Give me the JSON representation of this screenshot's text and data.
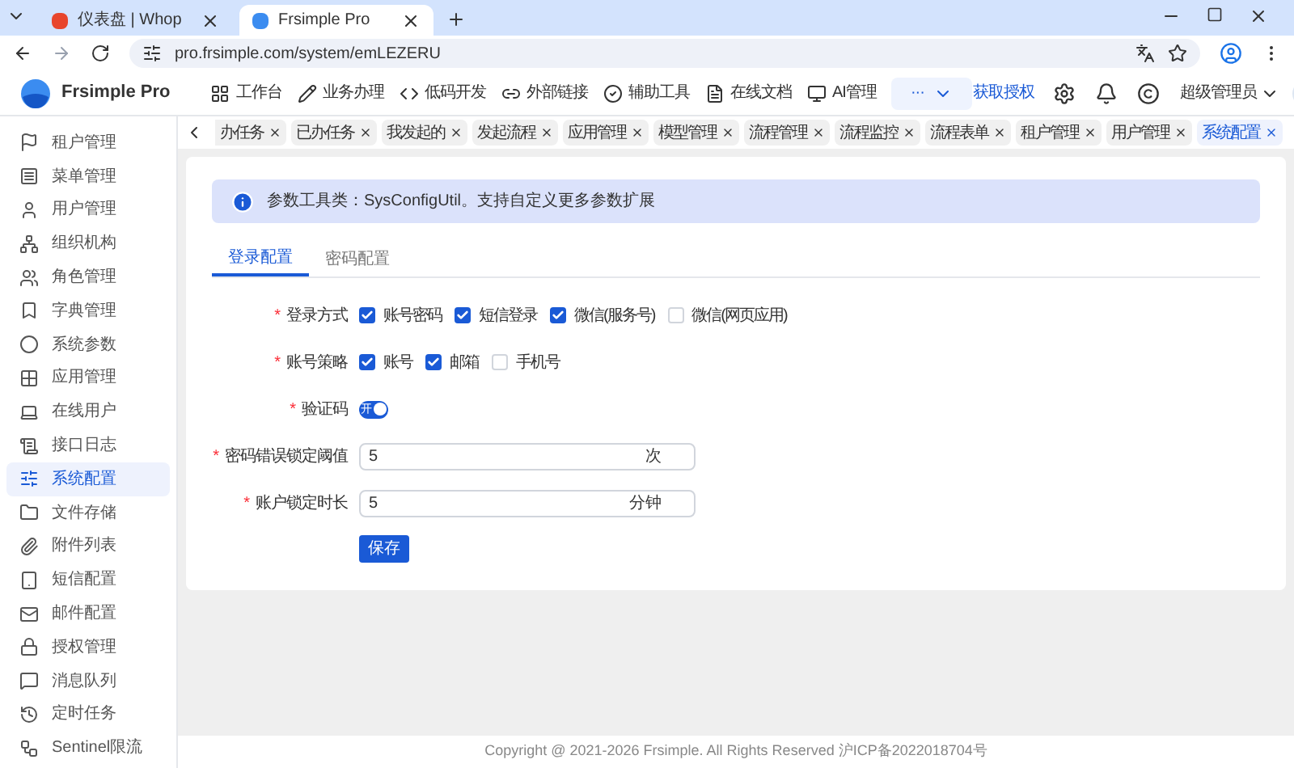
{
  "browser": {
    "tabs": [
      {
        "title": "仪表盘 | Whop",
        "selected": false
      },
      {
        "title": "Frsimple Pro",
        "selected": true
      }
    ],
    "url": "pro.frsimple.com/system/emLEZERU"
  },
  "header": {
    "logo_text": "Frsimple Pro",
    "nav": [
      {
        "label": "工作台"
      },
      {
        "label": "业务办理"
      },
      {
        "label": "低码开发"
      },
      {
        "label": "外部链接"
      },
      {
        "label": "辅助工具"
      },
      {
        "label": "在线文档"
      },
      {
        "label": "AI管理"
      }
    ],
    "more": "···",
    "license_link": "获取授权",
    "user": "超级管理员"
  },
  "sidebar": {
    "items": [
      {
        "label": "租户管理",
        "selected": false
      },
      {
        "label": "菜单管理",
        "selected": false
      },
      {
        "label": "用户管理",
        "selected": false
      },
      {
        "label": "组织机构",
        "selected": false
      },
      {
        "label": "角色管理",
        "selected": false
      },
      {
        "label": "字典管理",
        "selected": false
      },
      {
        "label": "系统参数",
        "selected": false
      },
      {
        "label": "应用管理",
        "selected": false
      },
      {
        "label": "在线用户",
        "selected": false
      },
      {
        "label": "接口日志",
        "selected": false
      },
      {
        "label": "系统配置",
        "selected": true
      },
      {
        "label": "文件存储",
        "selected": false
      },
      {
        "label": "附件列表",
        "selected": false
      },
      {
        "label": "短信配置",
        "selected": false
      },
      {
        "label": "邮件配置",
        "selected": false
      },
      {
        "label": "授权管理",
        "selected": false
      },
      {
        "label": "消息队列",
        "selected": false
      },
      {
        "label": "定时任务",
        "selected": false
      },
      {
        "label": "Sentinel限流",
        "selected": false
      }
    ]
  },
  "page_tabs": [
    {
      "label": "办任务",
      "selected": false
    },
    {
      "label": "已办任务",
      "selected": false
    },
    {
      "label": "我发起的",
      "selected": false
    },
    {
      "label": "发起流程",
      "selected": false
    },
    {
      "label": "应用管理",
      "selected": false
    },
    {
      "label": "模型管理",
      "selected": false
    },
    {
      "label": "流程管理",
      "selected": false
    },
    {
      "label": "流程监控",
      "selected": false
    },
    {
      "label": "流程表单",
      "selected": false
    },
    {
      "label": "租户管理",
      "selected": false
    },
    {
      "label": "用户管理",
      "selected": false
    },
    {
      "label": "系统配置",
      "selected": true
    }
  ],
  "alert": "参数工具类：SysConfigUtil。支持自定义更多参数扩展",
  "form_tabs": [
    {
      "label": "登录配置",
      "selected": true
    },
    {
      "label": "密码配置",
      "selected": false
    }
  ],
  "fields": [
    {
      "kind": "checkboxes",
      "label": "登录方式",
      "required": true,
      "options": [
        {
          "label": "账号密码",
          "checked": true
        },
        {
          "label": "短信登录",
          "checked": true
        },
        {
          "label": "微信(服务号)",
          "checked": true
        },
        {
          "label": "微信(网页应用)",
          "checked": false
        }
      ]
    },
    {
      "kind": "checkboxes",
      "label": "账号策略",
      "required": true,
      "options": [
        {
          "label": "账号",
          "checked": true
        },
        {
          "label": "邮箱",
          "checked": true
        },
        {
          "label": "手机号",
          "checked": false
        }
      ]
    },
    {
      "kind": "switch",
      "label": "验证码",
      "required": true,
      "on": true,
      "on_text": "开"
    },
    {
      "kind": "input",
      "label": "密码错误锁定阈值",
      "required": true,
      "value": "5",
      "suffix": "次"
    },
    {
      "kind": "input",
      "label": "账户锁定时长",
      "required": true,
      "value": "5",
      "suffix": "分钟"
    }
  ],
  "required_mark": "*",
  "save_button": "保存",
  "footer": "Copyright @ 2021-2026 Frsimple. All Rights Reserved 沪ICP备2022018704号"
}
